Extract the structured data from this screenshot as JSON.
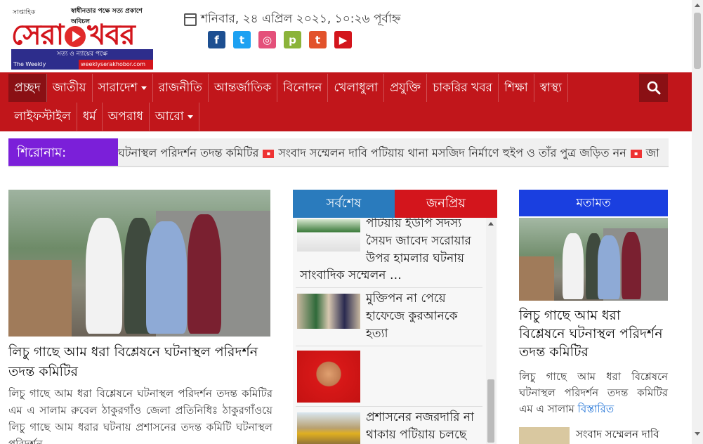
{
  "logo": {
    "small_left": "সাপ্তাহিক",
    "small_top": "স্বাধীনতার পক্ষে সত্য প্রকাশে অবিচল",
    "brand_a": "সেরা",
    "brand_b": "খবর",
    "tagline": "সত্য ও ন্যায়ের পক্ষে",
    "strip_left": "The Weekly Serakhobor",
    "strip_right": "weeklyserakhobor.com"
  },
  "date": "শনিবার, ২৪ এপ্রিল ২০২১, ১০:২৬ পূর্বাহ্ন",
  "social": [
    {
      "icon": "facebook-icon",
      "glyph": "f",
      "color": "#1d4f91"
    },
    {
      "icon": "twitter-icon",
      "glyph": "t",
      "color": "#1da1f2"
    },
    {
      "icon": "instagram-icon",
      "glyph": "◎",
      "color": "#e4507a"
    },
    {
      "icon": "pinterest-icon",
      "glyph": "p",
      "color": "#8bb33a"
    },
    {
      "icon": "tumblr-icon",
      "glyph": "t",
      "color": "#e2522b"
    },
    {
      "icon": "youtube-icon",
      "glyph": "▶",
      "color": "#d3151c"
    }
  ],
  "nav": {
    "row1": [
      "প্রচ্ছদ",
      "জাতীয়",
      "সারাদেশ",
      "রাজনীতি",
      "আন্তর্জাতিক",
      "বিনোদন",
      "খেলাধুলা",
      "প্রযুক্তি",
      "চাকরির খবর",
      "শিক্ষা",
      "স্বাস্থ্য"
    ],
    "row2": [
      "লাইফস্টাইল",
      "ধর্ম",
      "অপরাধ",
      "আরো"
    ]
  },
  "ticker": {
    "label": "শিরোনাম:",
    "item1": "ঘটনাস্থল পরিদর্শন তদন্ত কমিটির",
    "item2": "সংবাদ সম্মেলন দাবি পটিয়ায় থানা মসজিদ নির্মাণে হুইপ ও তাঁর পুত্র জড়িত নন",
    "item3": "জা"
  },
  "main": {
    "title": "লিচু গাছে আম ধরা বিশ্লেষনে ঘটনাস্থল পরিদর্শন তদন্ত কমিটির",
    "body": "লিচু গাছে আম ধরা বিশ্লেষনে ঘটনাস্থল পরিদর্শন তদন্ত কমিটির এম এ সালাম রুবেল ঠাকুরগাঁও জেলা প্রতিনিধিঃ ঠাকুরগাঁওয়ে লিচু গাছে আম ধরার ঘটনায় প্রশাসনের তদন্ত কমিটি ঘটনাস্থল পরিদর্শন"
  },
  "tabs": {
    "latest": "সর্বশেষ",
    "popular": "জনপ্রিয়"
  },
  "midlist": [
    {
      "line1": "পটিয়ায় ইউপি সদস্য",
      "line2": "সৈয়দ জাবেদ সরোয়ার",
      "line3": "উপর হামলার ঘটনায়",
      "line4": "সাংবাদিক সম্মেলন …"
    },
    {
      "line1": "মুক্তিপন না পেয়ে",
      "line2": "হাফেজে কুরআনকে",
      "line3": "হত্যা"
    },
    {
      "line1": "",
      "line2": ""
    },
    {
      "line1": "প্রশাসনের নজরদারি না",
      "line2": "থাকায় পটিয়ায় চলছে"
    }
  ],
  "right": {
    "header": "মতামত",
    "title": "লিচু গাছে আম ধরা বিশ্লেষনে ঘটনাস্থল পরিদর্শন তদন্ত কমিটির",
    "body": "লিচু গাছে আম ধরা বিশ্লেষনে ঘটনাস্থল পরিদর্শন তদন্ত কমিটির এম এ সালাম",
    "more": "বিস্তারিত",
    "next": "সংবাদ সম্মেলন দাবি"
  }
}
